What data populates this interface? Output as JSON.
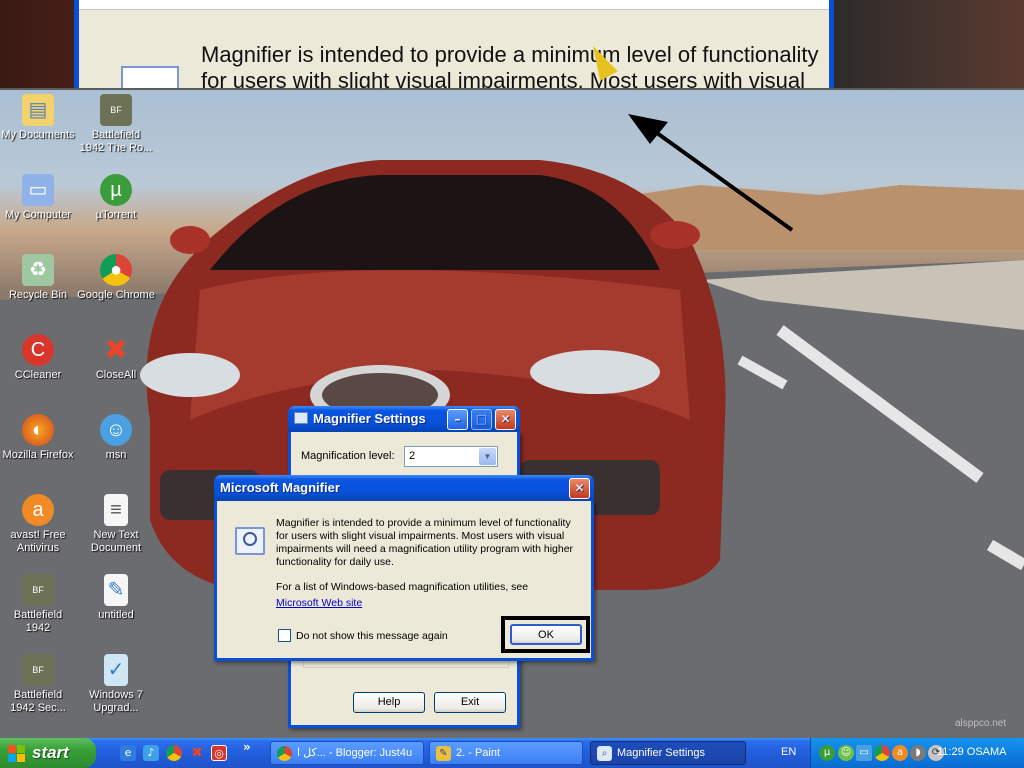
{
  "colors": {
    "xp_blue": "#0a4fd8",
    "window_face": "#ece9d8",
    "start_green": "#37a037",
    "link": "#0000cc"
  },
  "magnifier_view": {
    "line1": "Magnifier is intended to provide a minimum level of functionality",
    "line2": "for users with slight visual impairments. Most users with visual"
  },
  "desktop_icons": [
    {
      "label": "My Documents",
      "icon": "folder-documents-icon"
    },
    {
      "label": "Battlefield\n1942 The Ro...",
      "icon": "battlefield-icon"
    },
    {
      "label": "My Computer",
      "icon": "computer-icon"
    },
    {
      "label": "µTorrent",
      "icon": "utorrent-icon"
    },
    {
      "label": "Recycle Bin",
      "icon": "recycle-bin-icon"
    },
    {
      "label": "Google Chrome",
      "icon": "chrome-icon"
    },
    {
      "label": "CCleaner",
      "icon": "ccleaner-icon"
    },
    {
      "label": "CloseAll",
      "icon": "closeall-icon"
    },
    {
      "label": "Mozilla Firefox",
      "icon": "firefox-icon"
    },
    {
      "label": "msn",
      "icon": "msn-icon"
    },
    {
      "label": "avast! Free\nAntivirus",
      "icon": "avast-icon"
    },
    {
      "label": "New Text\nDocument",
      "icon": "text-document-icon"
    },
    {
      "label": "Battlefield\n1942",
      "icon": "battlefield-icon"
    },
    {
      "label": "untitled",
      "icon": "image-file-icon"
    },
    {
      "label": "Battlefield\n1942 Sec...",
      "icon": "battlefield-icon"
    },
    {
      "label": "Windows 7\nUpgrad...",
      "icon": "windows7-upgrade-icon"
    }
  ],
  "magnifier_settings": {
    "title": "Magnifier Settings",
    "level_label": "Magnification level:",
    "level_value": "2",
    "help_label": "Help",
    "exit_label": "Exit"
  },
  "dialog": {
    "title": "Microsoft Magnifier",
    "message": "Magnifier is intended to provide a minimum level of functionality for users with slight visual impairments. Most users with visual impairments will need a magnification utility program with higher functionality for daily use.",
    "list_text": "For a list of Windows-based magnification utilities, see",
    "link_text": "Microsoft Web site",
    "checkbox_label": "Do not show this message again",
    "checkbox_checked": false,
    "ok_label": "OK"
  },
  "taskbar": {
    "start_label": "start",
    "overflow_label": "»",
    "tasks": [
      {
        "label": "كل ا... - Blogger: Just4u",
        "icon": "chrome-icon",
        "active": false
      },
      {
        "label": "2. - Paint",
        "icon": "paint-icon",
        "active": false
      },
      {
        "label": "Magnifier Settings",
        "icon": "magnifier-icon",
        "active": true
      }
    ],
    "language": "EN",
    "clock": "11:29 OSAMA"
  },
  "watermark": "alsppco.net"
}
